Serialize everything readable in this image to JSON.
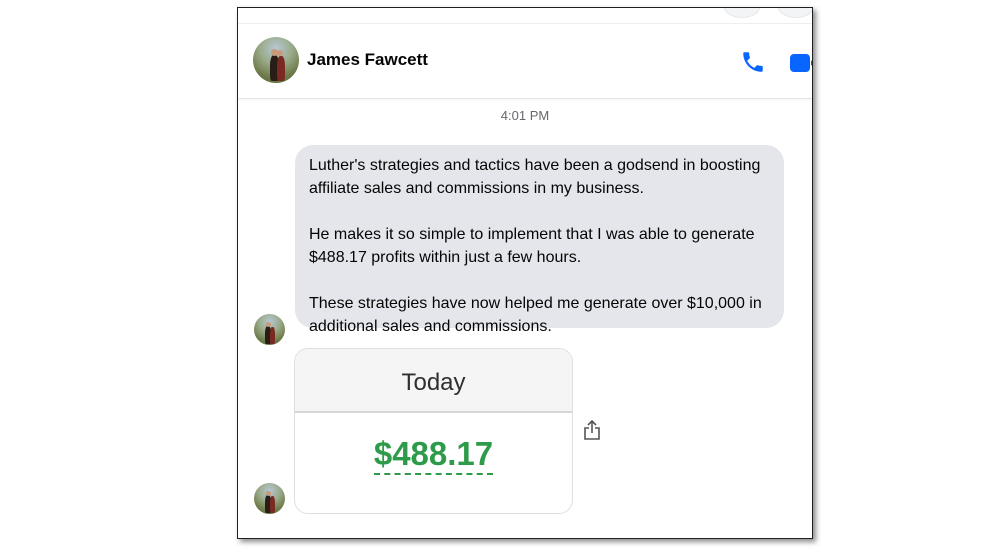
{
  "window": {
    "contact": {
      "name": "James Fawcett"
    },
    "icons": {
      "phone": "phone-icon",
      "video": "video-camera-icon",
      "share": "share-icon",
      "avatar": "avatar"
    },
    "colors": {
      "accent": "#0866ff",
      "bubble": "#e4e6eb",
      "amount": "#2e9b4a"
    }
  },
  "conversation": {
    "timestamp": "4:01 PM",
    "message": {
      "paragraphs": [
        "Luther's strategies and tactics have been a godsend in boosting affiliate sales and commissions in my business.",
        "He makes it so simple to implement that I was able to generate $488.17 profits within just a few hours.",
        "These strategies have now helped me generate over $10,000 in additional sales and commissions."
      ]
    },
    "attachment": {
      "header": "Today",
      "amount": "$488.17"
    }
  }
}
